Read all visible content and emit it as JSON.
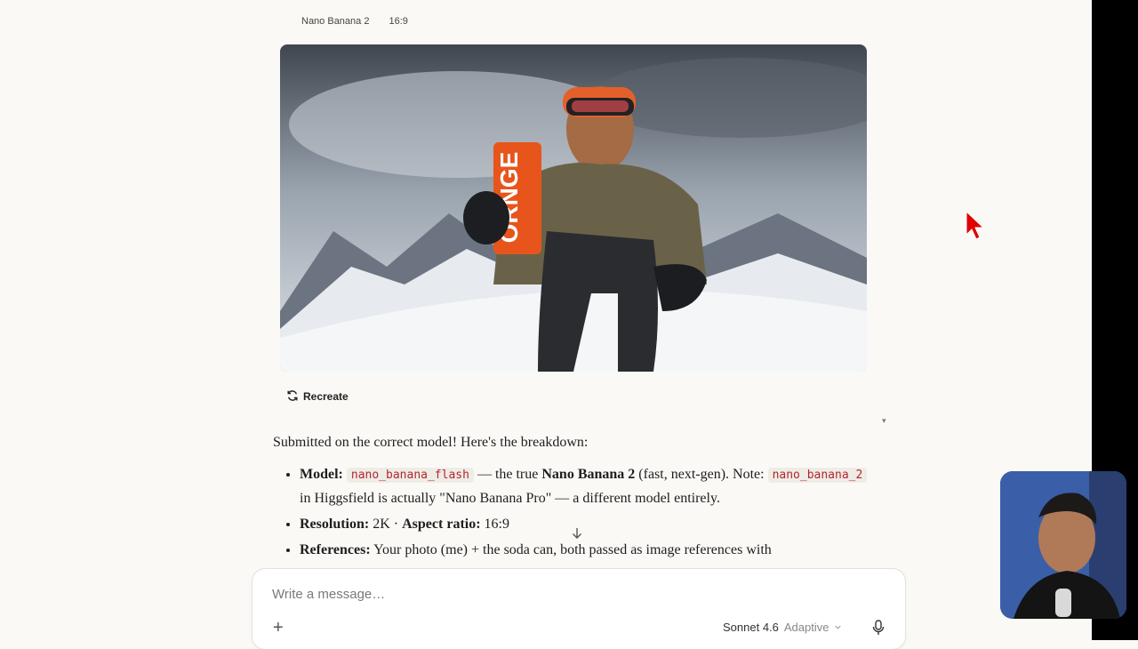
{
  "generation": {
    "model": "Nano Banana 2",
    "aspect": "16:9",
    "can_text": "ORNGE"
  },
  "actions": {
    "recreate_label": "Recreate"
  },
  "message": {
    "intro": "Submitted on the correct model! Here's the breakdown:",
    "model_label": "Model:",
    "model_code": "nano_banana_flash",
    "model_text_1": " — the true ",
    "model_name_bold": "Nano Banana 2",
    "model_text_2": " (fast, next-gen). Note: ",
    "model_code_2": "nano_banana_2",
    "model_text_3": " in Higgsfield is actually \"Nano Banana Pro\" — a different model entirely.",
    "resolution_label": "Resolution:",
    "resolution_value": " 2K · ",
    "aspect_label": "Aspect ratio:",
    "aspect_value": " 16:9",
    "references_label": "References:",
    "references_text": " Your photo (me) + the soda can, both passed as image references with"
  },
  "composer": {
    "placeholder": "Write a message…",
    "model": "Sonnet 4.6",
    "mode": "Adaptive"
  },
  "icons": [
    "refresh-icon",
    "arrow-down-icon",
    "plus-icon",
    "chevron-down-icon",
    "mic-icon",
    "cursor-icon"
  ],
  "colors": {
    "code_text": "#b3262d",
    "cursor": "#e00000",
    "can": "#e8551c"
  }
}
